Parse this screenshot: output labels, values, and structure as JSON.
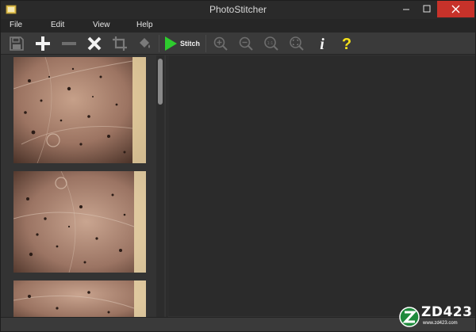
{
  "window": {
    "title": "PhotoStitcher"
  },
  "menu": {
    "items": [
      "File",
      "Edit",
      "View",
      "Help"
    ]
  },
  "toolbar": {
    "buttons": [
      {
        "name": "save",
        "icon": "floppy-disk-icon",
        "enabled": false
      },
      {
        "name": "add",
        "icon": "plus-icon",
        "enabled": true
      },
      {
        "name": "remove",
        "icon": "minus-icon",
        "enabled": false
      },
      {
        "name": "delete",
        "icon": "x-icon",
        "enabled": true
      },
      {
        "name": "crop",
        "icon": "crop-icon",
        "enabled": false
      },
      {
        "name": "fill",
        "icon": "paint-bucket-icon",
        "enabled": false
      },
      {
        "name": "stitch",
        "icon": "play-triangle-icon",
        "enabled": true
      },
      {
        "name": "zoom-in",
        "icon": "zoom-in-icon",
        "enabled": false
      },
      {
        "name": "zoom-out",
        "icon": "zoom-out-icon",
        "enabled": false
      },
      {
        "name": "zoom-actual",
        "icon": "zoom-1-1-icon",
        "enabled": false
      },
      {
        "name": "zoom-fit",
        "icon": "zoom-fit-icon",
        "enabled": false
      },
      {
        "name": "info",
        "icon": "info-icon",
        "enabled": true
      },
      {
        "name": "help",
        "icon": "question-icon",
        "enabled": true
      }
    ],
    "stitch_label": "Stitch",
    "zoom_actual_label": "1:1",
    "info_label": "i",
    "help_label": "?"
  },
  "thumbnails": [
    {
      "name": "photo-1"
    },
    {
      "name": "photo-2"
    },
    {
      "name": "photo-3"
    }
  ],
  "colors": {
    "stitch_green": "#2ecc2e",
    "help_yellow": "#f5e21a",
    "close_red": "#c7322a"
  },
  "watermark": {
    "main": "ZD423",
    "sub": "www.zd423.com"
  }
}
